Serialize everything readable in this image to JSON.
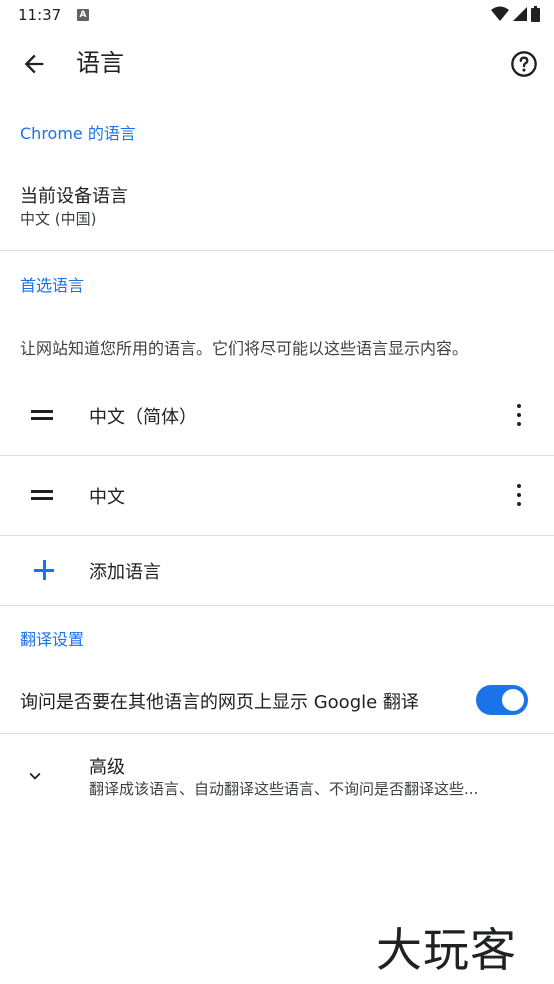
{
  "status_bar": {
    "time": "11:37",
    "notification_glyph": "A"
  },
  "app_bar": {
    "title": "语言"
  },
  "sections": {
    "chrome_lang_header": "Chrome 的语言",
    "device_lang_title": "当前设备语言",
    "device_lang_value": "中文 (中国)",
    "preferred_header": "首选语言",
    "preferred_desc": "让网站知道您所用的语言。它们将尽可能以这些语言显示内容。",
    "languages": [
      {
        "label": "中文（简体）"
      },
      {
        "label": "中文"
      }
    ],
    "add_language": "添加语言",
    "translate_header": "翻译设置",
    "translate_toggle_label": "询问是否要在其他语言的网页上显示 Google 翻译",
    "translate_toggle_on": true,
    "advanced_title": "高级",
    "advanced_summary": "翻译成该语言、自动翻译这些语言、不询问是否翻译这些..."
  },
  "watermark": "大玩客",
  "colors": {
    "accent": "#1a73e8",
    "divider": "#dadce0",
    "text": "#202124"
  },
  "icons": [
    "back-arrow-icon",
    "help-icon",
    "drag-handle-icon",
    "more-vert-icon",
    "add-icon",
    "chevron-down-icon",
    "wifi-icon",
    "signal-icon",
    "battery-icon"
  ]
}
